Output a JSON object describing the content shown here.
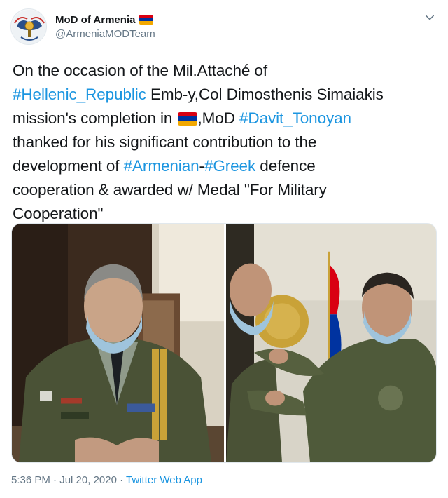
{
  "account": {
    "display_name": "MoD of Armenia",
    "handle": "@ArmeniaMODTeam",
    "avatar_icon": "ministry-of-defence-emblem",
    "name_flag": "armenia-flag"
  },
  "menu": {
    "icon": "chevron-down-icon"
  },
  "tweet": {
    "line1": "On the occasion of the Mil.Attaché of",
    "hashtag_hellenic": "#Hellenic_Republic",
    "line2_rest": " Emb-y,Col Dimosthenis Simaiakis",
    "line3_start": "mission's completion in ",
    "line3_mod": ",MoD ",
    "hashtag_davit": "#Davit_Tonoyan",
    "line4": "thanked for his significant contribution to the",
    "line5_start": "development of ",
    "hashtag_armenian": "#Armenian",
    "dash": "-",
    "hashtag_greek": "#Greek",
    "line5_end": " defence",
    "line6": "cooperation & awarded w/ Medal \"For Military",
    "line7": "Cooperation\""
  },
  "media": {
    "photo_left": "photo-officer-seated",
    "photo_right": "photo-medal-ceremony"
  },
  "meta": {
    "time": "5:36 PM",
    "sep1": " · ",
    "date": "Jul 20, 2020",
    "sep2": " · ",
    "source": "Twitter Web App"
  },
  "colors": {
    "link": "#1b95e0",
    "secondary": "#657786",
    "flag_red": "#d90012",
    "flag_blue": "#0033a0",
    "flag_orange": "#f2a800"
  }
}
